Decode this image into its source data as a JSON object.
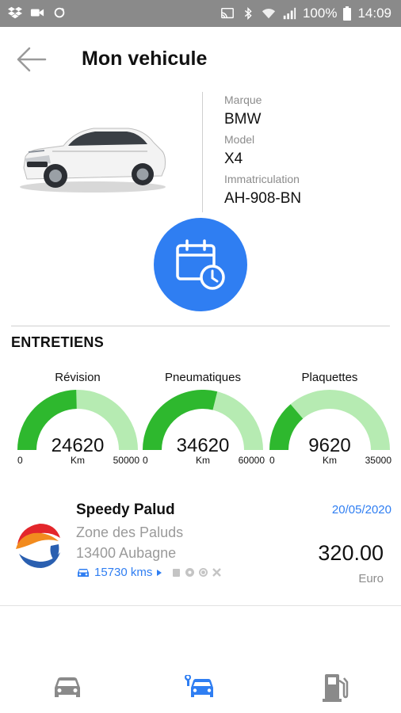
{
  "status_bar": {
    "battery": "100%",
    "time": "14:09"
  },
  "header": {
    "title": "Mon vehicule"
  },
  "vehicle": {
    "brand_label": "Marque",
    "brand_value": "BMW",
    "model_label": "Model",
    "model_value": "X4",
    "plate_label": "Immatriculation",
    "plate_value": "AH-908-BN"
  },
  "maintenance": {
    "section_title": "ENTRETIENS",
    "gauges": [
      {
        "label": "Révision",
        "value": "24620",
        "value_num": 24620,
        "unit": "Km",
        "min": "0",
        "max": "50000",
        "max_num": 50000
      },
      {
        "label": "Pneumatiques",
        "value": "34620",
        "value_num": 34620,
        "unit": "Km",
        "min": "0",
        "max": "60000",
        "max_num": 60000
      },
      {
        "label": "Plaquettes",
        "value": "9620",
        "value_num": 9620,
        "unit": "Km",
        "min": "0",
        "max": "35000",
        "max_num": 35000
      }
    ]
  },
  "last_service": {
    "garage_name": "Speedy Palud",
    "date": "20/05/2020",
    "address_line1": "Zone des Paluds",
    "address_line2": "13400 Aubagne",
    "mileage": "15730 kms",
    "price": "320.00",
    "currency": "Euro"
  },
  "colors": {
    "accent": "#2f7ef2",
    "gauge_fill": "#2eb82e",
    "gauge_track": "#b6ebb2",
    "status_bar": "#8a8a8a"
  },
  "icons": {
    "back": "arrow-left-icon",
    "calendar": "calendar-clock-icon",
    "nav": [
      "car-icon",
      "car-service-icon",
      "fuel-pump-icon"
    ]
  }
}
